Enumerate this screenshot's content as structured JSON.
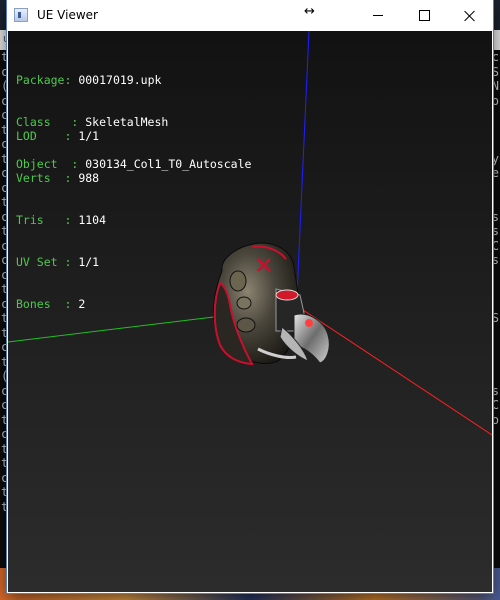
{
  "window": {
    "title": "UE Viewer"
  },
  "info": {
    "package_label": "Package",
    "package": "00017019.upk",
    "class_label": "Class",
    "class": "SkeletalMesh",
    "object_label": "Object",
    "object": "030134_Col1_T0_Autoscale"
  },
  "stats": [
    {
      "label": "LOD",
      "value": "1/1"
    },
    {
      "label": "Verts",
      "value": "988"
    },
    {
      "label": "Tris",
      "value": "1104"
    },
    {
      "label": "UV Set",
      "value": "1/1"
    },
    {
      "label": "Bones",
      "value": "2"
    }
  ],
  "background": {
    "left_terminal_chars": [
      "t",
      "c",
      "(",
      "c",
      "c",
      "t",
      "c",
      "t",
      "c",
      "c",
      "t",
      "c",
      "t",
      "c",
      "c",
      "c",
      "t",
      "c",
      "t",
      "t",
      "c",
      "t",
      "(",
      "c",
      "c",
      "t",
      "c",
      "t",
      "t",
      "c",
      "t",
      "t"
    ],
    "right_terminal_chars": [
      "c",
      "S",
      "N",
      "o",
      "",
      "",
      "",
      "y",
      "e",
      "",
      "",
      "s",
      "s",
      "C",
      "s",
      "",
      "",
      "",
      "S",
      "",
      "",
      "",
      "",
      "s",
      "C",
      "o",
      "",
      ""
    ],
    "strip_text": "u"
  },
  "colors": {
    "axis_x": "#ff2020",
    "axis_y": "#20c020",
    "axis_z": "#2020ff",
    "label_green": "#4ec94e",
    "value_white": "#ffffff"
  }
}
